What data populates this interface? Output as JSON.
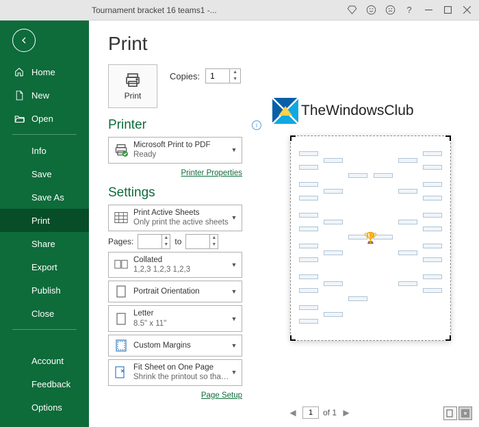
{
  "window": {
    "title": "Tournament bracket 16 teams1  -..."
  },
  "sidebar": {
    "home": "Home",
    "new": "New",
    "open": "Open",
    "info": "Info",
    "save": "Save",
    "saveas": "Save As",
    "print": "Print",
    "share": "Share",
    "export": "Export",
    "publish": "Publish",
    "close": "Close",
    "account": "Account",
    "feedback": "Feedback",
    "options": "Options"
  },
  "page": {
    "title": "Print",
    "printbtn": "Print",
    "copies_label": "Copies:",
    "copies_value": "1",
    "printer_title": "Printer",
    "printer_name": "Microsoft Print to PDF",
    "printer_status": "Ready",
    "printer_props": "Printer Properties",
    "settings_title": "Settings",
    "active_sheets_l1": "Print Active Sheets",
    "active_sheets_l2": "Only print the active sheets",
    "pages_label": "Pages:",
    "to_label": "to",
    "collated_l1": "Collated",
    "collated_l2": "1,2,3    1,2,3    1,2,3",
    "orientation": "Portrait Orientation",
    "paper_l1": "Letter",
    "paper_l2": "8.5\" x 11\"",
    "margins": "Custom Margins",
    "scaling_l1": "Fit Sheet on One Page",
    "scaling_l2": "Shrink the printout so that it...",
    "page_setup": "Page Setup"
  },
  "watermark": "TheWindowsClub",
  "pager": {
    "current": "1",
    "of": "of 1"
  }
}
